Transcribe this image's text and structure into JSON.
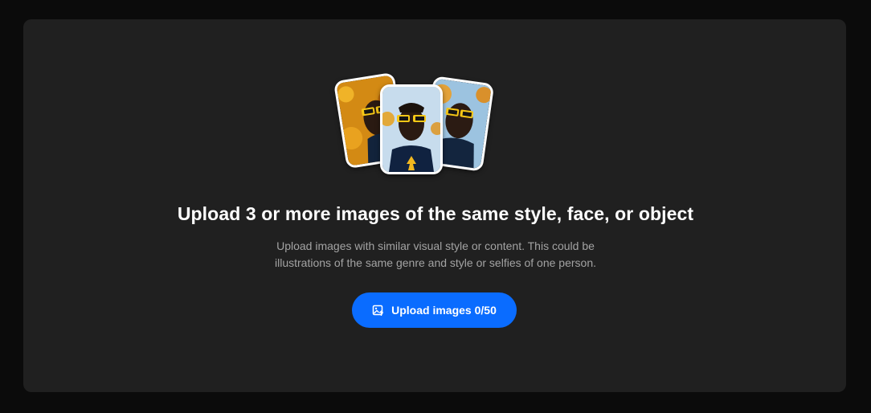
{
  "headline": "Upload 3 or more images of the same style, face, or object",
  "description_line1": "Upload images with similar visual style or content. This could be",
  "description_line2": "illustrations of the same genre and style or selfies of one person.",
  "upload_button": {
    "label": "Upload images",
    "count": "0/50",
    "icon": "image-upload-icon"
  },
  "colors": {
    "background": "#0b0b0b",
    "panel": "#202020",
    "accent": "#0a6cff",
    "headline_text": "#ffffff",
    "description_text": "#a3a3a3"
  },
  "example_images": [
    {
      "icon": "portrait-image-left"
    },
    {
      "icon": "portrait-image-center"
    },
    {
      "icon": "portrait-image-right"
    }
  ]
}
